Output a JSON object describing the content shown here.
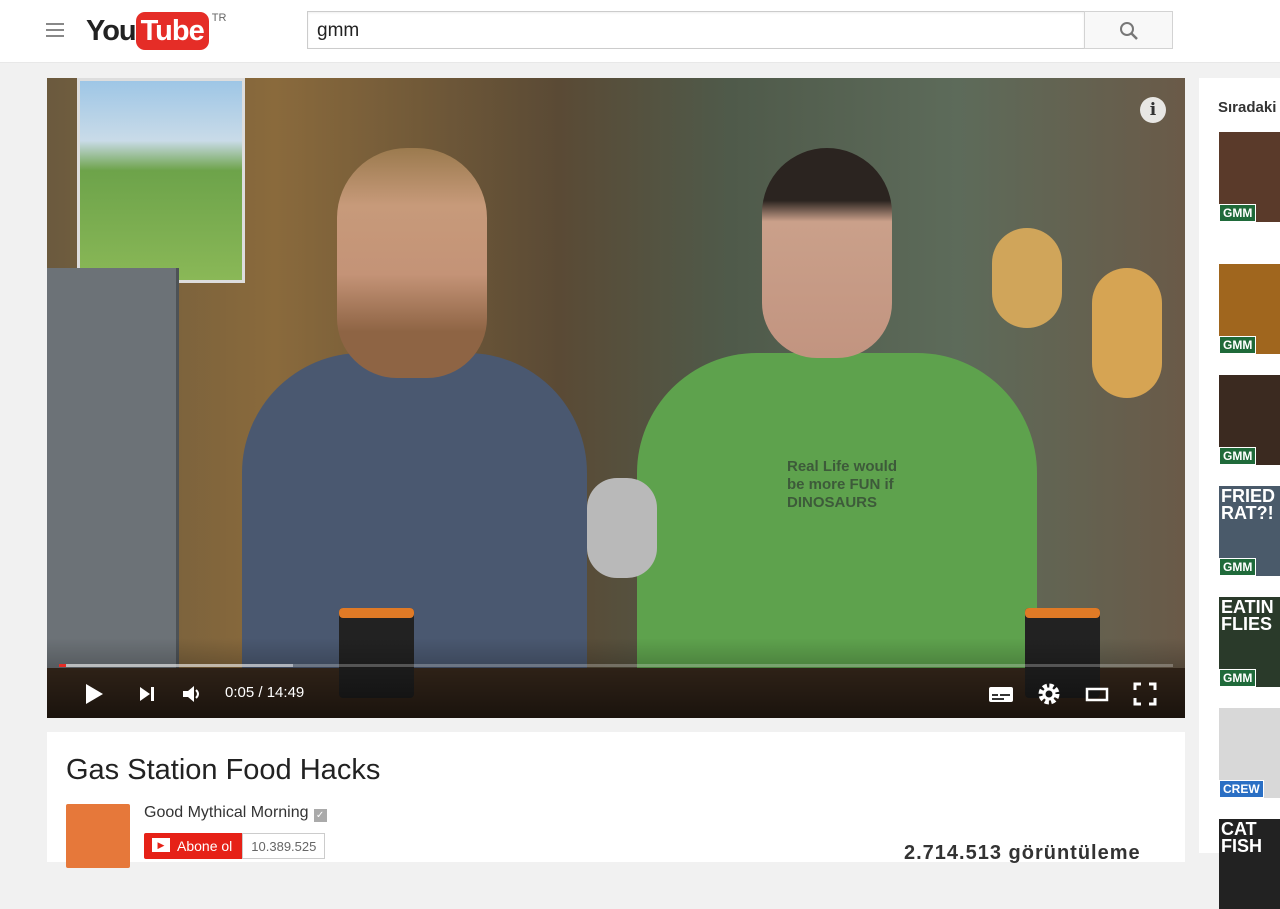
{
  "masthead": {
    "logo_you": "You",
    "logo_tube": "Tube",
    "country": "TR",
    "search_value": "gmm",
    "icons": [
      "menu-icon",
      "search-icon"
    ]
  },
  "player": {
    "current_time": "0:05",
    "duration": "14:49",
    "time_separator": " / ",
    "progress_percent": 0.6,
    "buffered_percent": 21,
    "shirt_text": "Real Life would be more FUN if DINOSAURS",
    "accent": "#e52d27"
  },
  "sidebar": {
    "heading": "Sıradaki",
    "items": [
      {
        "badge": "GMM",
        "text": ""
      },
      {
        "badge": "GMM",
        "text": ""
      },
      {
        "badge": "GMM",
        "text": ""
      },
      {
        "badge": "GMM",
        "text": "FRIED RAT?!"
      },
      {
        "badge": "GMM",
        "text": "EATIN FLIES"
      },
      {
        "badge": "CREW",
        "text": ""
      },
      {
        "badge": "",
        "text": "CAT FISH"
      }
    ]
  },
  "video": {
    "title": "Gas Station Food Hacks",
    "channel": "Good Mythical Morning",
    "subscribe_label": "Abone ol",
    "subscriber_count": "10.389.525",
    "views": "2.714.513 görüntüleme"
  }
}
